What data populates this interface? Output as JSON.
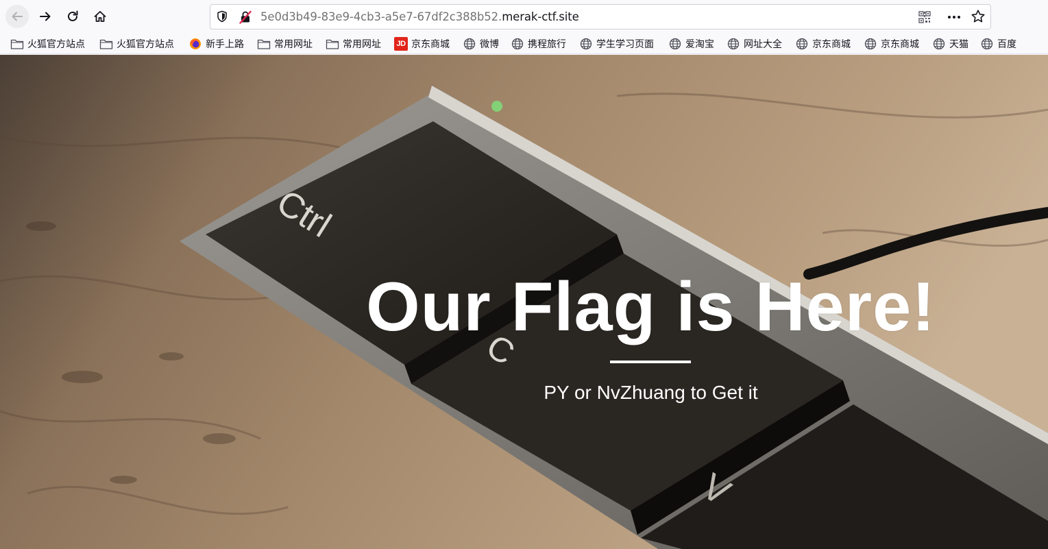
{
  "browser": {
    "url_path": "5e0d3b49-83e9-4cb3-a5e7-67df2c388b52.",
    "url_host": "merak-ctf.site"
  },
  "bookmarks": [
    {
      "label": "火狐官方站点",
      "icon": "folder-icon"
    },
    {
      "label": "火狐官方站点",
      "icon": "folder-icon"
    },
    {
      "label": "新手上路",
      "icon": "firefox-icon"
    },
    {
      "label": "常用网址",
      "icon": "folder-icon"
    },
    {
      "label": "常用网址",
      "icon": "folder-icon"
    },
    {
      "label": "京东商城",
      "icon": "jd-icon",
      "icon_text": "JD"
    },
    {
      "label": "微博",
      "icon": "globe-icon"
    },
    {
      "label": "携程旅行",
      "icon": "globe-icon"
    },
    {
      "label": "学生学习页面",
      "icon": "globe-icon"
    },
    {
      "label": "爱淘宝",
      "icon": "globe-icon"
    },
    {
      "label": "网址大全",
      "icon": "globe-icon"
    },
    {
      "label": "京东商城",
      "icon": "globe-icon"
    },
    {
      "label": "京东商城",
      "icon": "globe-icon"
    },
    {
      "label": "天猫",
      "icon": "globe-icon"
    },
    {
      "label": "百度",
      "icon": "globe-icon"
    }
  ],
  "hero": {
    "title": "Our Flag is Here!",
    "subtitle": "PY or NvZhuang to Get it",
    "background": "keyboard-ctrl-c-v-image"
  },
  "keycaps": {
    "ctrl": "Ctrl",
    "c": "C",
    "v": "V"
  },
  "colors": {
    "urlbar_border": "#cfcfd8",
    "toolbar_bg": "#f9f9fb",
    "jd_red": "#e1251b",
    "insecure_red": "#e22850"
  }
}
